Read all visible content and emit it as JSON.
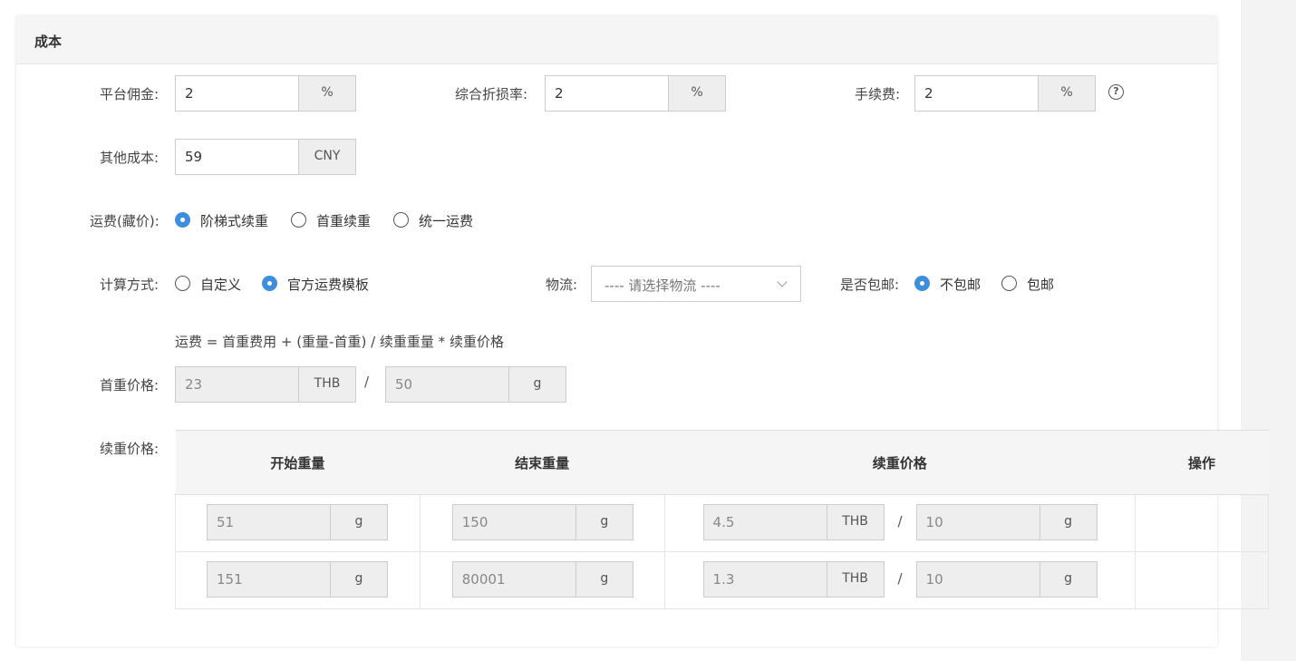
{
  "section": {
    "title": "成本"
  },
  "commission": {
    "label": "平台佣金:",
    "value": "2",
    "unit": "%"
  },
  "loss_rate": {
    "label": "综合折损率:",
    "value": "2",
    "unit": "%"
  },
  "fee": {
    "label": "手续费:",
    "value": "2",
    "unit": "%",
    "help_icon": "question-circle-icon"
  },
  "other_cost": {
    "label": "其他成本:",
    "value": "59",
    "unit": "CNY"
  },
  "shipping": {
    "label": "运费(藏价):",
    "options": [
      {
        "label": "阶梯式续重",
        "checked": true
      },
      {
        "label": "首重续重",
        "checked": false
      },
      {
        "label": "统一运费",
        "checked": false
      }
    ]
  },
  "calc": {
    "label": "计算方式:",
    "options": [
      {
        "label": "自定义",
        "checked": false
      },
      {
        "label": "官方运费模板",
        "checked": true
      }
    ]
  },
  "logistics": {
    "label": "物流:",
    "placeholder": "---- 请选择物流 ----"
  },
  "free_shipping": {
    "label": "是否包邮:",
    "options": [
      {
        "label": "不包邮",
        "checked": true
      },
      {
        "label": "包邮",
        "checked": false
      }
    ]
  },
  "formula": "运费 = 首重费用 + (重量-首重) / 续重重量 * 续重价格",
  "first_weight": {
    "label": "首重价格:",
    "price": "23",
    "currency": "THB",
    "separator": "/",
    "weight": "50",
    "weight_unit": "g"
  },
  "tier": {
    "label": "续重价格:",
    "headers": [
      "开始重量",
      "结束重量",
      "续重价格",
      "操作"
    ],
    "rows": [
      {
        "start": "51",
        "start_unit": "g",
        "end": "150",
        "end_unit": "g",
        "price": "4.5",
        "currency": "THB",
        "sep": "/",
        "per": "10",
        "per_unit": "g"
      },
      {
        "start": "151",
        "start_unit": "g",
        "end": "80001",
        "end_unit": "g",
        "price": "1.3",
        "currency": "THB",
        "sep": "/",
        "per": "10",
        "per_unit": "g"
      }
    ]
  },
  "colors": {
    "accent": "#3d8ede",
    "header_bg": "#f5f5f5",
    "addon_bg": "#eeeeee"
  }
}
